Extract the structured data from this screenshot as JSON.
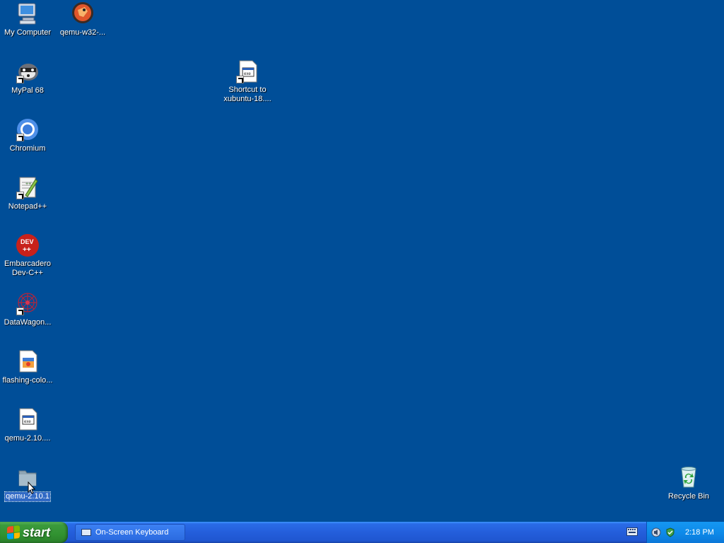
{
  "desktop": {
    "icons": [
      {
        "label": "My Computer"
      },
      {
        "label": "qemu-w32-..."
      },
      {
        "label": "MyPal 68"
      },
      {
        "label": "Shortcut to\nxubuntu-18...."
      },
      {
        "label": "Chromium"
      },
      {
        "label": "Notepad++"
      },
      {
        "label": "Embarcadero\nDev-C++"
      },
      {
        "label": "DataWagon..."
      },
      {
        "label": "flashing-colo..."
      },
      {
        "label": "qemu-2.10...."
      },
      {
        "label": "qemu-2.10.1"
      },
      {
        "label": "Recycle Bin"
      }
    ]
  },
  "taskbar": {
    "start_label": "start",
    "tasks": [
      {
        "label": "On-Screen Keyboard"
      }
    ],
    "clock": "2:18 PM"
  },
  "colors": {
    "desktop_bg": "#004e98",
    "taskbar_blue": "#245edb",
    "start_green": "#3c9a3c",
    "tray_blue": "#0e8bea"
  }
}
